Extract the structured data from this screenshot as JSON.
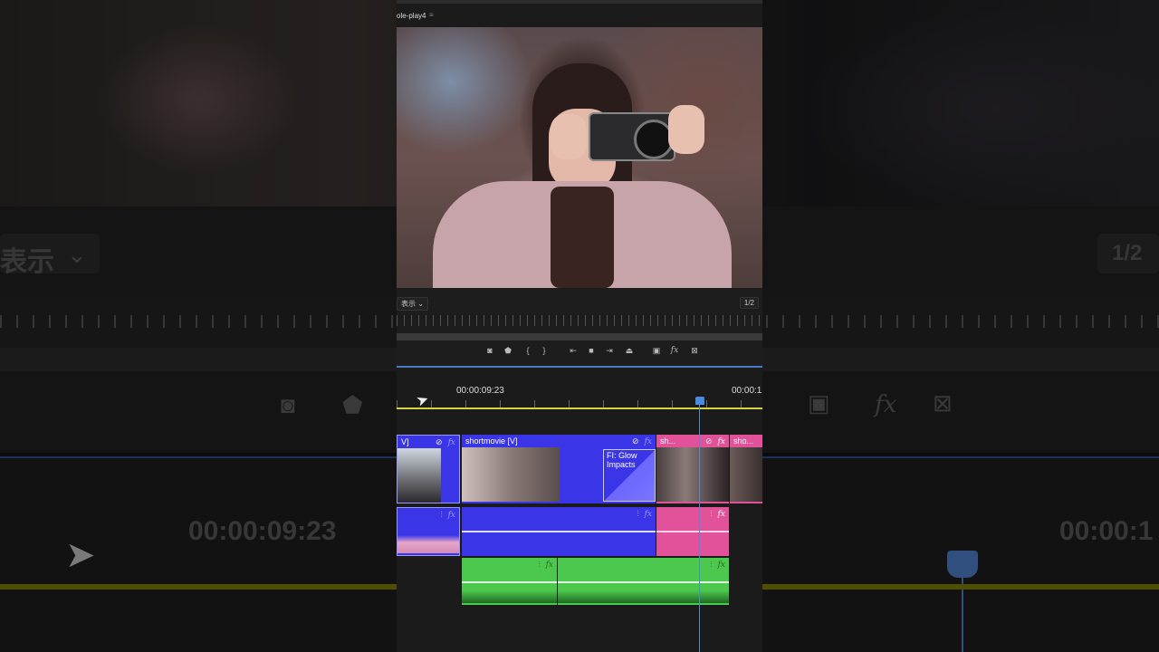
{
  "background": {
    "left_text": "表示",
    "right_page": "1/2",
    "timecode_left": "00:00:09:23",
    "timecode_right": "00:00:1"
  },
  "program_monitor": {
    "sequence_name": "ole-play4",
    "menu_icon": "≡",
    "fit_label": "表示",
    "page_indicator": "1/2"
  },
  "transport": {
    "buttons": [
      "camera-icon",
      "marker-icon",
      "in-point-icon",
      "out-point-icon",
      "go-to-in-icon",
      "stop-icon",
      "go-to-out-icon",
      "lift-icon",
      "compare-icon",
      "fx-icon",
      "export-frame-icon"
    ]
  },
  "timeline": {
    "timecode_current": "00:00:09:23",
    "timecode_next": "00:00:1",
    "clips": {
      "v_left_label": "V]",
      "v_main_label": "shortmovie [V]",
      "v_pink1_label": "sh...",
      "v_pink2_label": "sho...",
      "effect_label": "FI: Glow Impacts"
    },
    "colors": {
      "video_clip": "#3b35e8",
      "pink_clip": "#e2529a",
      "audio_green": "#4cc84e",
      "playhead": "#4a8be0",
      "work_area": "#d7d33a"
    }
  }
}
